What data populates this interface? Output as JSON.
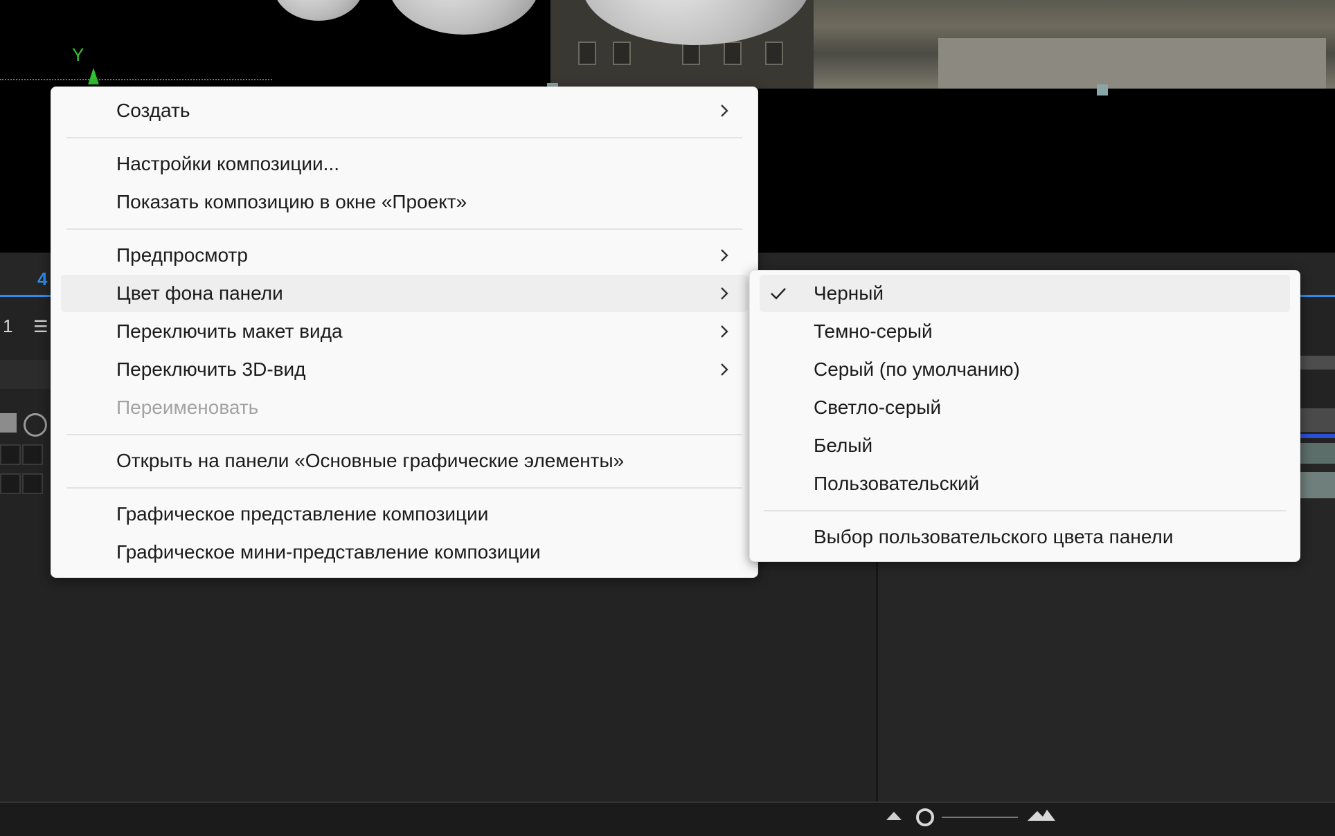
{
  "background": {
    "axis_label": "Y",
    "tab_number": "4",
    "timeline_number": "1",
    "accent_color": "#2d8ceb"
  },
  "context_menu": {
    "items": [
      {
        "label": "Создать",
        "submenu": true
      },
      {
        "label": "Настройки композиции...",
        "submenu": false
      },
      {
        "label": "Показать композицию в окне «Проект»",
        "submenu": false
      },
      {
        "label": "Предпросмотр",
        "submenu": true
      },
      {
        "label": "Цвет фона панели",
        "submenu": true,
        "highlighted": true
      },
      {
        "label": "Переключить макет вида",
        "submenu": true
      },
      {
        "label": "Переключить 3D-вид",
        "submenu": true
      },
      {
        "label": "Переименовать",
        "submenu": false,
        "disabled": true
      },
      {
        "label": "Открыть на панели «Основные графические элементы»",
        "submenu": false
      },
      {
        "label": "Графическое представление композиции",
        "submenu": false
      },
      {
        "label": "Графическое мини-представление композиции",
        "submenu": false
      }
    ]
  },
  "panel_color_submenu": {
    "items": [
      {
        "label": "Черный",
        "checked": true,
        "highlighted": true
      },
      {
        "label": "Темно-серый",
        "checked": false
      },
      {
        "label": "Серый (по умолчанию)",
        "checked": false
      },
      {
        "label": "Светло-серый",
        "checked": false
      },
      {
        "label": "Белый",
        "checked": false
      },
      {
        "label": "Пользовательский",
        "checked": false
      },
      {
        "label": "Выбор пользовательского цвета панели",
        "checked": false
      }
    ]
  },
  "icons": {
    "submenu_arrow": "chevron-right-icon",
    "checkmark": "check-icon",
    "zoom_out": "zoom-out-mountain-icon",
    "zoom_in": "zoom-in-mountain-icon"
  }
}
